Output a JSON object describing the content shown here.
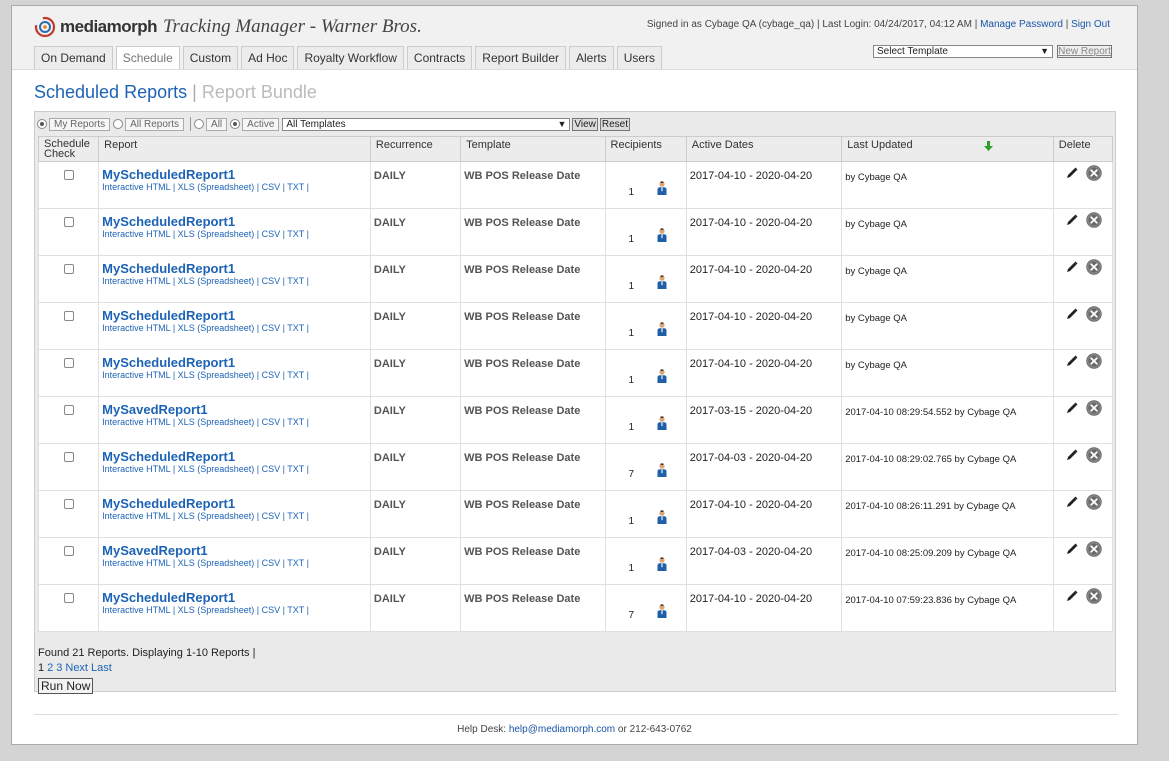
{
  "app": {
    "brand": "mediamorph",
    "title": "Tracking Manager - Warner Bros."
  },
  "signin": {
    "text": "Signed in as Cybage QA (cybage_qa) | Last Login: 04/24/2017, 04:12 AM |",
    "manage_password": "Manage Password",
    "sign_out": "Sign Out"
  },
  "nav": {
    "tabs": [
      {
        "label": "On Demand"
      },
      {
        "label": "Schedule",
        "active": true
      },
      {
        "label": "Custom"
      },
      {
        "label": "Ad Hoc"
      },
      {
        "label": "Royalty Workflow"
      },
      {
        "label": "Contracts"
      },
      {
        "label": "Report Builder"
      },
      {
        "label": "Alerts"
      },
      {
        "label": "Users"
      }
    ]
  },
  "template_select": {
    "value": "Select Template",
    "new_report": "New Report"
  },
  "page": {
    "title_active": "Scheduled Reports",
    "title_sep": "|",
    "title_inactive": "Report Bundle"
  },
  "filters": {
    "my_reports": "My Reports",
    "all_reports": "All Reports",
    "all": "All",
    "active": "Active",
    "templates_value": "All Templates",
    "view": "View",
    "reset": "Reset"
  },
  "table": {
    "headers": {
      "schedule_check": "Schedule Check",
      "report": "Report",
      "recurrence": "Recurrence",
      "template": "Template",
      "recipients": "Recipients",
      "active_dates": "Active Dates",
      "last_updated": "Last Updated",
      "delete": "Delete"
    },
    "rows": [
      {
        "name": "MyScheduledReport1",
        "links": "Interactive HTML | XLS (Spreadsheet) | CSV | TXT |",
        "recurrence": "DAILY",
        "template": "WB POS Release Date",
        "recipients": "1",
        "dates": "2017-04-10 - 2020-04-20",
        "updated": "by Cybage QA"
      },
      {
        "name": "MyScheduledReport1",
        "links": "Interactive HTML | XLS (Spreadsheet) | CSV | TXT |",
        "recurrence": "DAILY",
        "template": "WB POS Release Date",
        "recipients": "1",
        "dates": "2017-04-10 - 2020-04-20",
        "updated": "by Cybage QA"
      },
      {
        "name": "MyScheduledReport1",
        "links": "Interactive HTML | XLS (Spreadsheet) | CSV | TXT |",
        "recurrence": "DAILY",
        "template": "WB POS Release Date",
        "recipients": "1",
        "dates": "2017-04-10 - 2020-04-20",
        "updated": "by Cybage QA"
      },
      {
        "name": "MyScheduledReport1",
        "links": "Interactive HTML | XLS (Spreadsheet) | CSV | TXT |",
        "recurrence": "DAILY",
        "template": "WB POS Release Date",
        "recipients": "1",
        "dates": "2017-04-10 - 2020-04-20",
        "updated": "by Cybage QA"
      },
      {
        "name": "MyScheduledReport1",
        "links": "Interactive HTML | XLS (Spreadsheet) | CSV | TXT |",
        "recurrence": "DAILY",
        "template": "WB POS Release Date",
        "recipients": "1",
        "dates": "2017-04-10 - 2020-04-20",
        "updated": "by Cybage QA"
      },
      {
        "name": "MySavedReport1",
        "links": "Interactive HTML | XLS (Spreadsheet) | CSV | TXT |",
        "recurrence": "DAILY",
        "template": "WB POS Release Date",
        "recipients": "1",
        "dates": "2017-03-15 - 2020-04-20",
        "updated": "2017-04-10 08:29:54.552 by Cybage QA"
      },
      {
        "name": "MyScheduledReport1",
        "links": "Interactive HTML | XLS (Spreadsheet) | CSV | TXT |",
        "recurrence": "DAILY",
        "template": "WB POS Release Date",
        "recipients": "7",
        "dates": "2017-04-03 - 2020-04-20",
        "updated": "2017-04-10 08:29:02.765 by Cybage QA"
      },
      {
        "name": "MyScheduledReport1",
        "links": "Interactive HTML | XLS (Spreadsheet) | CSV | TXT |",
        "recurrence": "DAILY",
        "template": "WB POS Release Date",
        "recipients": "1",
        "dates": "2017-04-10 - 2020-04-20",
        "updated": "2017-04-10 08:26:11.291 by Cybage QA"
      },
      {
        "name": "MySavedReport1",
        "links": "Interactive HTML | XLS (Spreadsheet) | CSV | TXT |",
        "recurrence": "DAILY",
        "template": "WB POS Release Date",
        "recipients": "1",
        "dates": "2017-04-03 - 2020-04-20",
        "updated": "2017-04-10 08:25:09.209 by Cybage QA"
      },
      {
        "name": "MyScheduledReport1",
        "links": "Interactive HTML | XLS (Spreadsheet) | CSV | TXT |",
        "recurrence": "DAILY",
        "template": "WB POS Release Date",
        "recipients": "7",
        "dates": "2017-04-10 - 2020-04-20",
        "updated": "2017-04-10 07:59:23.836 by Cybage QA"
      }
    ]
  },
  "summary": {
    "found": "Found 21 Reports. Displaying 1-10 Reports |",
    "pages": [
      "1",
      "2",
      "3"
    ],
    "next": "Next",
    "last": "Last",
    "run_now": "Run Now"
  },
  "footer": {
    "prefix": "Help Desk:",
    "email": "help@mediamorph.com",
    "suffix": "or 212-643-0762"
  },
  "colors": {
    "link_blue": "#1d63b5",
    "sort_arrow_green": "#2aa02a"
  }
}
